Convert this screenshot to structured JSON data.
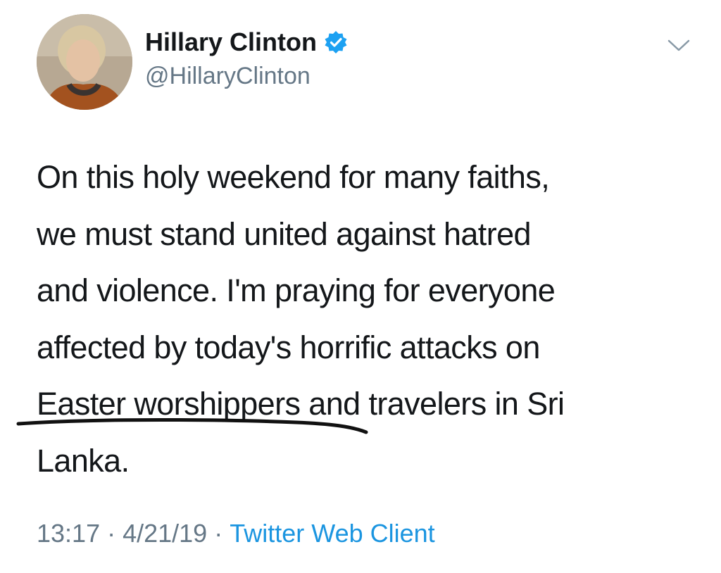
{
  "author": {
    "display_name": "Hillary Clinton",
    "handle": "@HillaryClinton",
    "verified": true,
    "avatar_icon": "profile-photo"
  },
  "tweet": {
    "lines": [
      "On this holy weekend for many faiths,",
      "we must stand united against hatred",
      "and violence. I'm praying for everyone",
      "affected by today's horrific attacks on",
      "Easter worshippers and travelers in Sri",
      "Lanka."
    ]
  },
  "meta": {
    "time": "13:17",
    "separator": "·",
    "date": "4/21/19",
    "source": "Twitter Web Client"
  },
  "colors": {
    "text": "#14171a",
    "secondary": "#657786",
    "link": "#1b95e0",
    "verified_badge": "#1da1f2"
  },
  "icons": [
    "verified-badge-icon",
    "chevron-down-icon",
    "hand-drawn-underline"
  ]
}
